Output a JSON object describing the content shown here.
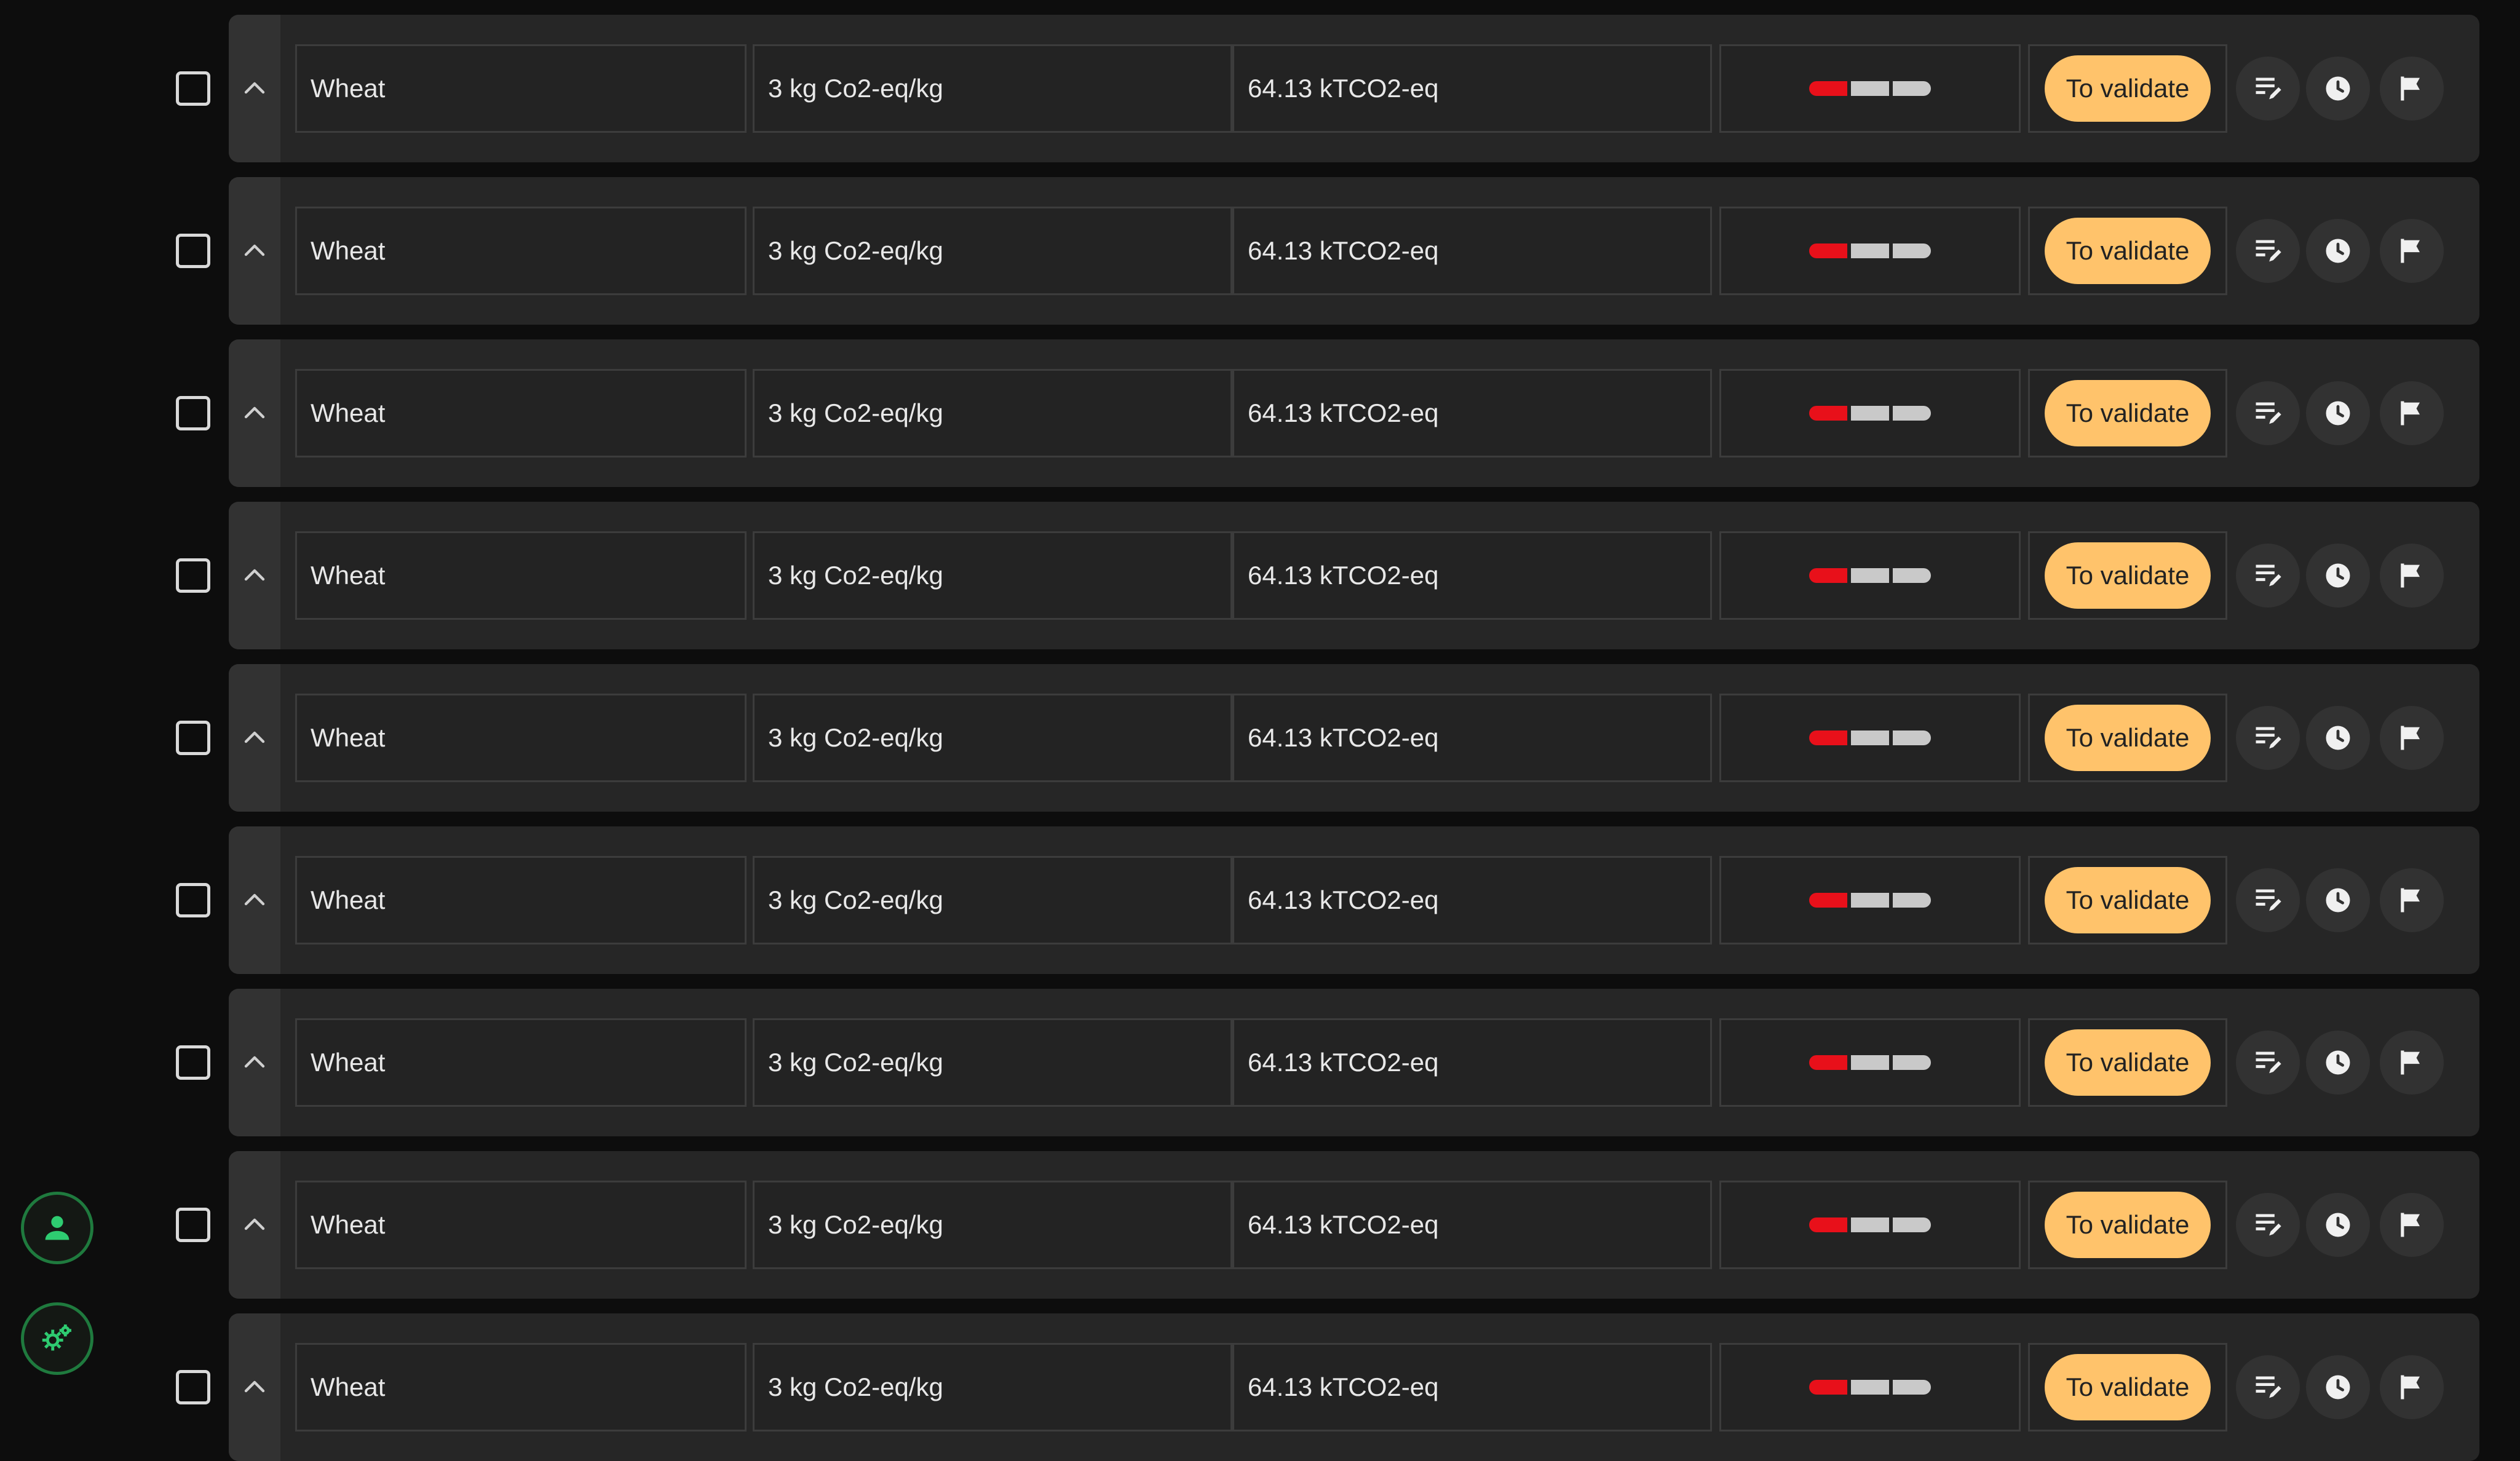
{
  "sidebar": {
    "user_icon": "person-icon",
    "settings_icon": "gears-icon",
    "accent_color": "#2ecc71"
  },
  "rows": [
    {
      "product": "Wheat",
      "emission_factor": "3 kg Co2-eq/kg",
      "total_emissions": "64.13 kTCO2-eq",
      "quality_level": 1,
      "quality_max": 3,
      "status": "To validate"
    },
    {
      "product": "Wheat",
      "emission_factor": "3 kg Co2-eq/kg",
      "total_emissions": "64.13 kTCO2-eq",
      "quality_level": 1,
      "quality_max": 3,
      "status": "To validate"
    },
    {
      "product": "Wheat",
      "emission_factor": "3 kg Co2-eq/kg",
      "total_emissions": "64.13 kTCO2-eq",
      "quality_level": 1,
      "quality_max": 3,
      "status": "To validate"
    },
    {
      "product": "Wheat",
      "emission_factor": "3 kg Co2-eq/kg",
      "total_emissions": "64.13 kTCO2-eq",
      "quality_level": 1,
      "quality_max": 3,
      "status": "To validate"
    },
    {
      "product": "Wheat",
      "emission_factor": "3 kg Co2-eq/kg",
      "total_emissions": "64.13 kTCO2-eq",
      "quality_level": 1,
      "quality_max": 3,
      "status": "To validate"
    },
    {
      "product": "Wheat",
      "emission_factor": "3 kg Co2-eq/kg",
      "total_emissions": "64.13 kTCO2-eq",
      "quality_level": 1,
      "quality_max": 3,
      "status": "To validate"
    },
    {
      "product": "Wheat",
      "emission_factor": "3 kg Co2-eq/kg",
      "total_emissions": "64.13 kTCO2-eq",
      "quality_level": 1,
      "quality_max": 3,
      "status": "To validate"
    },
    {
      "product": "Wheat",
      "emission_factor": "3 kg Co2-eq/kg",
      "total_emissions": "64.13 kTCO2-eq",
      "quality_level": 1,
      "quality_max": 3,
      "status": "To validate"
    },
    {
      "product": "Wheat",
      "emission_factor": "3 kg Co2-eq/kg",
      "total_emissions": "64.13 kTCO2-eq",
      "quality_level": 1,
      "quality_max": 3,
      "status": "To validate"
    }
  ],
  "row_icons": {
    "expand": "chevron-up-icon",
    "edit": "edit-note-icon",
    "history": "clock-icon",
    "flag": "flag-icon"
  },
  "colors": {
    "status_badge": "#ffc36b",
    "quality_active": "#e8101a",
    "quality_inactive": "#c9c9c9"
  }
}
